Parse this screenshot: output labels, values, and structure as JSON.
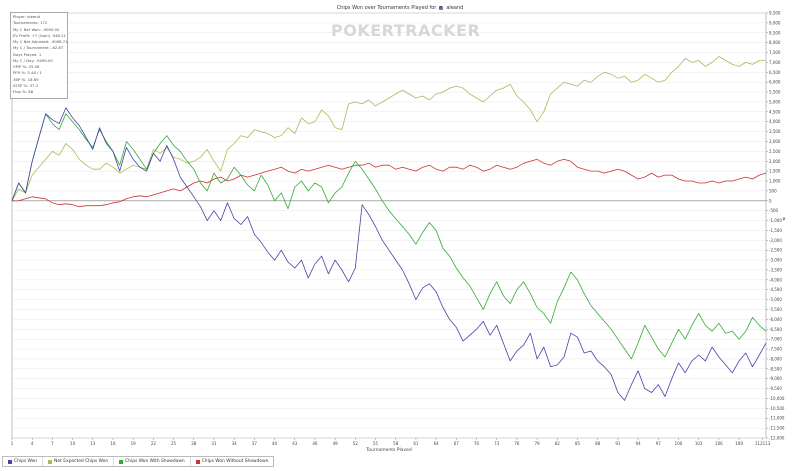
{
  "title": {
    "text": "Chips Won over Tournaments Played for",
    "player": "aleand"
  },
  "watermark": "POKERTRACKER",
  "stats": [
    "Player: aleand",
    "Tournaments: 172",
    "My C Net Won: -9090.00",
    "EV Profit: +7 (Gain) -946.21",
    "My C Net Adjusted: -9098.71",
    "My C / Tournament: -82.87",
    "Days Played: 1",
    "My C / Day: -9090.00",
    "VPIP %: 25.06",
    "PFR %: 5.48 / 1",
    "3BP %: 18.89",
    "ATSP %: 37.3",
    "Flop %: 88"
  ],
  "legend": [
    {
      "label": "Chips Won",
      "color": "#4444aa"
    },
    {
      "label": "Net Expected Chips Won",
      "color": "#aabb55"
    },
    {
      "label": "Chips Won With Showdown",
      "color": "#33aa33"
    },
    {
      "label": "Chips Won Without Showdown",
      "color": "#cc3333"
    }
  ],
  "chart_data": {
    "type": "line",
    "xlabel": "Tournaments Played",
    "ylabel": "#",
    "x_ticks": [
      "1",
      "4",
      "7",
      "10",
      "13",
      "16",
      "19",
      "22",
      "25",
      "28",
      "31",
      "34",
      "37",
      "40",
      "43",
      "46",
      "49",
      "52",
      "55",
      "58",
      "61",
      "64",
      "67",
      "70",
      "73",
      "76",
      "79",
      "82",
      "85",
      "88",
      "91",
      "94",
      "97",
      "100",
      "103",
      "106",
      "109",
      "112113"
    ],
    "ylim": [
      -12000,
      9500
    ],
    "y_ticks": [
      9500,
      9000,
      8500,
      8000,
      7500,
      7000,
      6500,
      6000,
      5500,
      5000,
      4500,
      4000,
      3500,
      3000,
      2500,
      2000,
      1500,
      1000,
      500,
      0,
      -500,
      -1000,
      -1500,
      -2000,
      -2500,
      -3000,
      -3500,
      -4000,
      -4500,
      -5000,
      -5500,
      -6000,
      -6500,
      -7000,
      -7500,
      -8000,
      -8500,
      -9000,
      -9500,
      -10000,
      -10500,
      -11000,
      -11500,
      -12000
    ],
    "y_tick_labels": [
      "9,500",
      "9,000",
      "8,500",
      "8,000",
      "7,500",
      "7,000",
      "6,500",
      "6,000",
      "5,500",
      "5,000",
      "4,500",
      "4,000",
      "3,500",
      "3,000",
      "2,500",
      "2,000",
      "1,500",
      "1,000",
      "500",
      "0",
      "-500",
      "-1,000",
      "-1,500",
      "-2,000",
      "-2,500",
      "-3,000",
      "-3,500",
      "-4,000",
      "-4,500",
      "-5,000",
      "-5,500",
      "-6,000",
      "-6,500",
      "-7,000",
      "-7,500",
      "-8,000",
      "-8,500",
      "-9,000",
      "-9,500",
      "-10,000",
      "-10,500",
      "-11,000",
      "-11,500",
      "-12,000"
    ],
    "grid": "horizontal",
    "series": [
      {
        "name": "Chips Won",
        "color": "#4444aa",
        "x": [
          1,
          2,
          3,
          4,
          5,
          6,
          7,
          8,
          9,
          10,
          11,
          12,
          13,
          14,
          15,
          16,
          17,
          18,
          19,
          20,
          21,
          22,
          23,
          24,
          25,
          26,
          27,
          28,
          29,
          30,
          31,
          32,
          33,
          34,
          35,
          36,
          37,
          38,
          39,
          40,
          41,
          42,
          43,
          44,
          45,
          46,
          47,
          48,
          49,
          50,
          51,
          52,
          53,
          54,
          55,
          56,
          57,
          58,
          59,
          60,
          61,
          62,
          63,
          64,
          65,
          66,
          67,
          68,
          69,
          70,
          71,
          72,
          73,
          74,
          75,
          76,
          77,
          78,
          79,
          80,
          81,
          82,
          83,
          84,
          85,
          86,
          87,
          88,
          89,
          90,
          91,
          92,
          93,
          94,
          95,
          96,
          97,
          98,
          99,
          100,
          101,
          102,
          103,
          104,
          105,
          106,
          107,
          108,
          109,
          110,
          111,
          112,
          113
        ],
        "y": [
          0,
          900,
          400,
          2000,
          3200,
          4400,
          4100,
          3900,
          4700,
          4200,
          3800,
          3200,
          2600,
          3700,
          2900,
          2500,
          1500,
          2700,
          2100,
          1700,
          1500,
          2400,
          2000,
          2800,
          2100,
          1200,
          700,
          200,
          -300,
          -1000,
          -500,
          -1000,
          -100,
          -900,
          -1200,
          -800,
          -1700,
          -2100,
          -2600,
          -3000,
          -2500,
          -3100,
          -3400,
          -3000,
          -3900,
          -3200,
          -2800,
          -3700,
          -3000,
          -3500,
          -4100,
          -3400,
          -200,
          -700,
          -1300,
          -2000,
          -2500,
          -3000,
          -3500,
          -4200,
          -5000,
          -4400,
          -4200,
          -4600,
          -5400,
          -6000,
          -6400,
          -7100,
          -6800,
          -6500,
          -6100,
          -6800,
          -6300,
          -7200,
          -8100,
          -7600,
          -7300,
          -6700,
          -8000,
          -7400,
          -8400,
          -8300,
          -7900,
          -6700,
          -6900,
          -7700,
          -7600,
          -8100,
          -8400,
          -8800,
          -9700,
          -10100,
          -9300,
          -8600,
          -9500,
          -9700,
          -9300,
          -9900,
          -9000,
          -8200,
          -8700,
          -8100,
          -7800,
          -8100,
          -7400,
          -7900,
          -8300,
          -8700,
          -8100,
          -7700,
          -8400,
          -7800,
          -7200
        ]
      },
      {
        "name": "Net Expected Chips Won",
        "color": "#aabb55",
        "x": [
          1,
          2,
          3,
          4,
          5,
          6,
          7,
          8,
          9,
          10,
          11,
          12,
          13,
          14,
          15,
          16,
          17,
          18,
          19,
          20,
          21,
          22,
          23,
          24,
          25,
          26,
          27,
          28,
          29,
          30,
          31,
          32,
          33,
          34,
          35,
          36,
          37,
          38,
          39,
          40,
          41,
          42,
          43,
          44,
          45,
          46,
          47,
          48,
          49,
          50,
          51,
          52,
          53,
          54,
          55,
          56,
          57,
          58,
          59,
          60,
          61,
          62,
          63,
          64,
          65,
          66,
          67,
          68,
          69,
          70,
          71,
          72,
          73,
          74,
          75,
          76,
          77,
          78,
          79,
          80,
          81,
          82,
          83,
          84,
          85,
          86,
          87,
          88,
          89,
          90,
          91,
          92,
          93,
          94,
          95,
          96,
          97,
          98,
          99,
          100,
          101,
          102,
          103,
          104,
          105,
          106,
          107,
          108,
          109,
          110,
          111,
          112,
          113
        ],
        "y": [
          0,
          600,
          400,
          1300,
          1700,
          2100,
          2500,
          2300,
          2900,
          2600,
          2100,
          1800,
          1600,
          1600,
          1900,
          1700,
          1400,
          1600,
          1800,
          1700,
          1600,
          2600,
          2400,
          2700,
          2200,
          2100,
          1900,
          2000,
          2200,
          2600,
          2000,
          1500,
          2600,
          2900,
          3300,
          3200,
          3600,
          3500,
          3400,
          3200,
          3300,
          3700,
          3400,
          4200,
          3900,
          4000,
          4600,
          4300,
          3700,
          3600,
          4900,
          5000,
          4900,
          5100,
          4800,
          5000,
          5200,
          5400,
          5600,
          5400,
          5200,
          5300,
          5100,
          5400,
          5500,
          5700,
          5800,
          5700,
          5400,
          5200,
          5000,
          5300,
          5600,
          5700,
          5900,
          5300,
          5000,
          4600,
          4000,
          4500,
          5400,
          5700,
          6000,
          5900,
          5800,
          6100,
          6000,
          6300,
          6500,
          6400,
          6200,
          6300,
          6000,
          6100,
          6400,
          6200,
          6000,
          6100,
          6500,
          6800,
          7200,
          7000,
          7100,
          6800,
          7000,
          7300,
          7100,
          6900,
          6800,
          7000,
          6900,
          7100,
          7100
        ]
      },
      {
        "name": "Chips Won With Showdown",
        "color": "#33aa33",
        "x": [
          1,
          2,
          3,
          4,
          5,
          6,
          7,
          8,
          9,
          10,
          11,
          12,
          13,
          14,
          15,
          16,
          17,
          18,
          19,
          20,
          21,
          22,
          23,
          24,
          25,
          26,
          27,
          28,
          29,
          30,
          31,
          32,
          33,
          34,
          35,
          36,
          37,
          38,
          39,
          40,
          41,
          42,
          43,
          44,
          45,
          46,
          47,
          48,
          49,
          50,
          51,
          52,
          53,
          54,
          55,
          56,
          57,
          58,
          59,
          60,
          61,
          62,
          63,
          64,
          65,
          66,
          67,
          68,
          69,
          70,
          71,
          72,
          73,
          74,
          75,
          76,
          77,
          78,
          79,
          80,
          81,
          82,
          83,
          84,
          85,
          86,
          87,
          88,
          89,
          90,
          91,
          92,
          93,
          94,
          95,
          96,
          97,
          98,
          99,
          100,
          101,
          102,
          103,
          104,
          105,
          106,
          107,
          108,
          109,
          110,
          111,
          112,
          113
        ],
        "y": [
          0,
          900,
          400,
          2000,
          3200,
          4400,
          3900,
          3600,
          4400,
          4000,
          3600,
          3100,
          2700,
          3600,
          3000,
          2500,
          1800,
          3000,
          2600,
          2100,
          1600,
          2400,
          2900,
          3300,
          2800,
          2500,
          2000,
          1600,
          900,
          500,
          1400,
          900,
          1100,
          1700,
          1300,
          800,
          500,
          1300,
          800,
          0,
          400,
          -400,
          700,
          1000,
          500,
          900,
          700,
          -100,
          400,
          700,
          1400,
          2000,
          1600,
          1100,
          600,
          0,
          -500,
          -900,
          -1300,
          -1700,
          -2200,
          -1600,
          -1100,
          -1500,
          -2400,
          -2800,
          -3400,
          -3900,
          -4300,
          -4900,
          -5500,
          -4700,
          -4100,
          -4800,
          -5200,
          -4500,
          -4100,
          -4700,
          -5400,
          -5700,
          -6200,
          -5100,
          -4400,
          -3600,
          -4000,
          -4700,
          -5300,
          -5700,
          -6100,
          -6500,
          -7000,
          -7500,
          -8000,
          -7200,
          -6300,
          -6900,
          -7500,
          -7900,
          -7200,
          -6500,
          -7000,
          -6300,
          -5700,
          -6300,
          -6600,
          -6200,
          -6700,
          -6600,
          -7000,
          -6600,
          -5900,
          -6300,
          -6600
        ]
      },
      {
        "name": "Chips Won Without Showdown",
        "color": "#cc3333",
        "x": [
          1,
          2,
          3,
          4,
          5,
          6,
          7,
          8,
          9,
          10,
          11,
          12,
          13,
          14,
          15,
          16,
          17,
          18,
          19,
          20,
          21,
          22,
          23,
          24,
          25,
          26,
          27,
          28,
          29,
          30,
          31,
          32,
          33,
          34,
          35,
          36,
          37,
          38,
          39,
          40,
          41,
          42,
          43,
          44,
          45,
          46,
          47,
          48,
          49,
          50,
          51,
          52,
          53,
          54,
          55,
          56,
          57,
          58,
          59,
          60,
          61,
          62,
          63,
          64,
          65,
          66,
          67,
          68,
          69,
          70,
          71,
          72,
          73,
          74,
          75,
          76,
          77,
          78,
          79,
          80,
          81,
          82,
          83,
          84,
          85,
          86,
          87,
          88,
          89,
          90,
          91,
          92,
          93,
          94,
          95,
          96,
          97,
          98,
          99,
          100,
          101,
          102,
          103,
          104,
          105,
          106,
          107,
          108,
          109,
          110,
          111,
          112,
          113
        ],
        "y": [
          0,
          0,
          100,
          200,
          150,
          100,
          -100,
          -200,
          -150,
          -200,
          -300,
          -250,
          -250,
          -250,
          -200,
          -100,
          -50,
          100,
          200,
          250,
          200,
          300,
          400,
          500,
          600,
          500,
          700,
          900,
          1000,
          900,
          1100,
          1200,
          1000,
          1100,
          1300,
          1200,
          1300,
          1400,
          1500,
          1600,
          1700,
          1500,
          1400,
          1600,
          1500,
          1600,
          1700,
          1800,
          1700,
          1600,
          1700,
          1800,
          1800,
          1900,
          1700,
          1800,
          1800,
          1600,
          1700,
          1600,
          1500,
          1700,
          1800,
          1600,
          1500,
          1700,
          1700,
          1600,
          1800,
          1700,
          1500,
          1600,
          1800,
          1700,
          1600,
          1700,
          1900,
          2000,
          2100,
          1900,
          1800,
          2000,
          2100,
          2000,
          1700,
          1600,
          1500,
          1500,
          1400,
          1500,
          1600,
          1500,
          1300,
          1100,
          1200,
          1400,
          1200,
          1300,
          1300,
          1100,
          1000,
          1000,
          900,
          900,
          1000,
          900,
          1000,
          1000,
          1100,
          1200,
          1100,
          1300,
          1400
        ]
      }
    ]
  }
}
